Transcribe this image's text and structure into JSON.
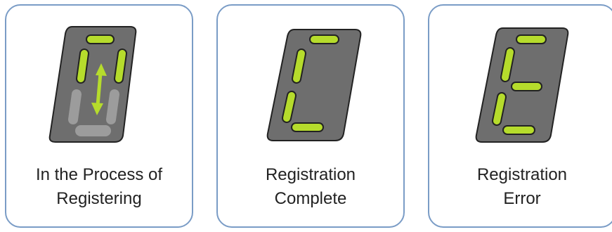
{
  "colors": {
    "card_border": "#7a9cc6",
    "display_body": "#6e6e6e",
    "display_outline": "#222222",
    "segment_lit": "#b6dc2c",
    "segment_dim": "#9c9c9c",
    "arrow": "#b6dc2c"
  },
  "cards": [
    {
      "caption_line1": "In the Process of",
      "caption_line2": "Registering",
      "icon": "registering-icon"
    },
    {
      "caption_line1": "Registration",
      "caption_line2": "Complete",
      "icon": "letter-c-display-icon"
    },
    {
      "caption_line1": "Registration",
      "caption_line2": "Error",
      "icon": "letter-e-display-icon"
    }
  ]
}
